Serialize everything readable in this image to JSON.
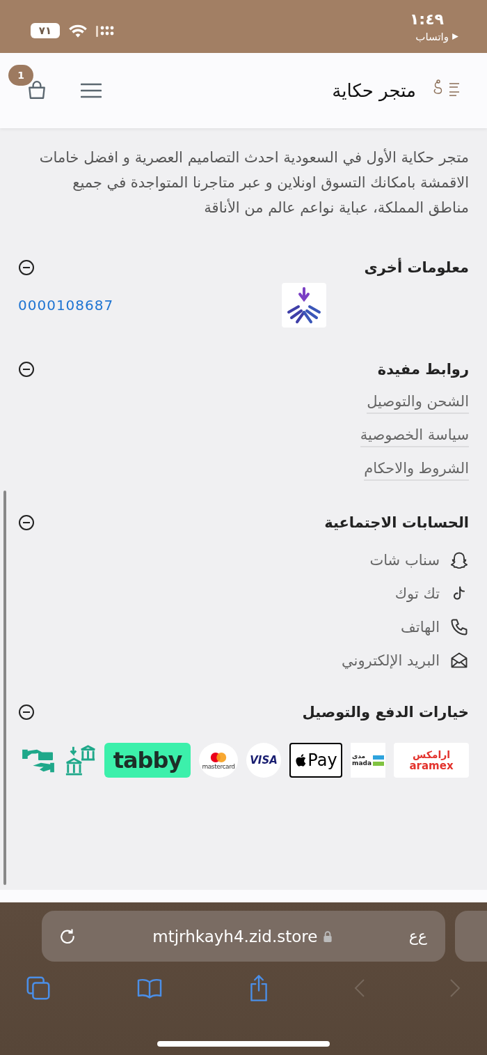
{
  "status_bar": {
    "time": "١:٤٩",
    "back_app": "واتساب",
    "battery": "٧١"
  },
  "header": {
    "store_name": "متجر حكاية",
    "cart_count": "1"
  },
  "description": "متجر حكاية الأول في السعودية احدث التصاميم العصرية و افضل خامات الاقمشة بامكانك التسوق اونلاين و عبر متاجرنا المتواجدة في جميع مناطق المملكة، عباية نواعم عالم من الأناقة",
  "sections": [
    {
      "kind": "info",
      "title": "معلومات أخرى",
      "expanded": true,
      "number": "0000108687"
    },
    {
      "kind": "links",
      "title": "روابط مفيدة",
      "expanded": true,
      "links": [
        "الشحن والتوصيل",
        "سياسة الخصوصية",
        "الشروط والاحكام"
      ]
    },
    {
      "kind": "social",
      "title": "الحسابات الاجتماعية",
      "expanded": true,
      "accounts": [
        {
          "kind": "snapchat",
          "label": "سناب شات"
        },
        {
          "kind": "tiktok",
          "label": "تك توك"
        },
        {
          "kind": "phone",
          "label": "الهاتف"
        },
        {
          "kind": "email",
          "label": "البريد الإلكتروني"
        }
      ]
    },
    {
      "kind": "payment",
      "title": "خيارات الدفع والتوصيل",
      "expanded": true,
      "methods": [
        {
          "kind": "aramex",
          "texts": [
            "ارامكس",
            "aramex"
          ]
        },
        {
          "kind": "mada",
          "texts": [
            "مدى",
            "mada"
          ]
        },
        {
          "kind": "applepay",
          "texts": [
            "Pay"
          ]
        },
        {
          "kind": "visa",
          "texts": [
            "VISA"
          ]
        },
        {
          "kind": "mastercard",
          "texts": [
            "mastercard"
          ]
        },
        {
          "kind": "tabby",
          "texts": [
            "tabby"
          ]
        },
        {
          "kind": "bank"
        },
        {
          "kind": "cash"
        }
      ]
    }
  ],
  "browser": {
    "url": "mtjrhkayh4.zid.store",
    "text_size": "ع‌ع"
  }
}
